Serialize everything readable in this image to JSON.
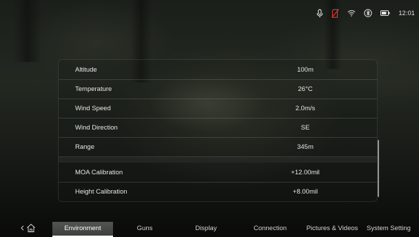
{
  "status": {
    "time": "12:01",
    "icons": [
      "microphone-icon",
      "no-sim-icon",
      "wifi-icon",
      "bluetooth-icon",
      "battery-icon"
    ],
    "alert_color": "#e53935"
  },
  "environment": {
    "rows": [
      {
        "label": "Altitude",
        "value": "100m"
      },
      {
        "label": "Temperature",
        "value": "26°C"
      },
      {
        "label": "Wind Speed",
        "value": "2.0m/s"
      },
      {
        "label": "Wind Direction",
        "value": "SE"
      },
      {
        "label": "Range",
        "value": "345m"
      }
    ],
    "calibration_rows": [
      {
        "label": "MOA Calibration",
        "value": "+12.00mil"
      },
      {
        "label": "Height Calibration",
        "value": "+8.00mil"
      }
    ]
  },
  "nav": {
    "back_icon": "home-back-icon",
    "tabs": [
      {
        "label": "Environment",
        "active": true
      },
      {
        "label": "Guns",
        "active": false
      },
      {
        "label": "Display",
        "active": false
      },
      {
        "label": "Connection",
        "active": false
      },
      {
        "label": "Pictures & Videos",
        "active": false
      },
      {
        "label": "System Setting",
        "active": false
      }
    ]
  }
}
